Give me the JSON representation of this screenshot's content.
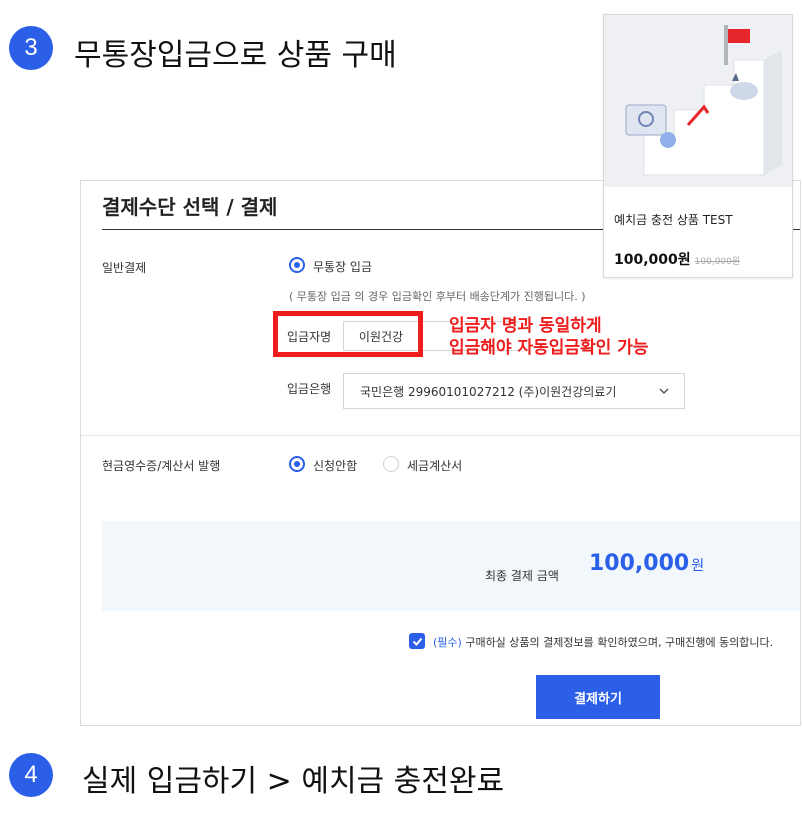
{
  "steps": [
    {
      "number": "3",
      "text": "무통장입금으로 상품 구매"
    },
    {
      "number": "4",
      "text": "실제 입금하기 > 예치금 충전완료"
    }
  ],
  "product": {
    "image_icon": "stairs-illustration-icon",
    "name": "예치금 충전 상품 TEST",
    "price": "100,000원",
    "original_price": "100,000원"
  },
  "payment": {
    "title": "결제수단 선택 / 결제",
    "general_label": "일반결제",
    "method_label": "무통장 입금",
    "notice": "( 무통장 입금 의 경우 입금확인 후부터 배송단계가 진행됩니다. )",
    "depositor_label": "입금자명",
    "depositor_value": "이원건강",
    "annotation_line1": "입금자 명과 동일하게",
    "annotation_line2": "입금해야 자동입금확인 가능",
    "bank_label": "입금은행",
    "bank_value": "국민은행 29960101027212 (주)이원건강의료기",
    "receipt_label": "현금영수증/계산서 발행",
    "receipt_option1": "신청안함",
    "receipt_option2": "세금계산서",
    "total_label": "최종 결제 금액",
    "total_amount": "100,000",
    "total_unit": "원",
    "agree_required": "(필수)",
    "agree_text": " 구매하실 상품의 결제정보를 확인하였으며, 구매진행에 동의합니다.",
    "pay_button": "결제하기"
  },
  "colors": {
    "accent": "#2b5fe8",
    "annotation": "#ee1c1c"
  }
}
